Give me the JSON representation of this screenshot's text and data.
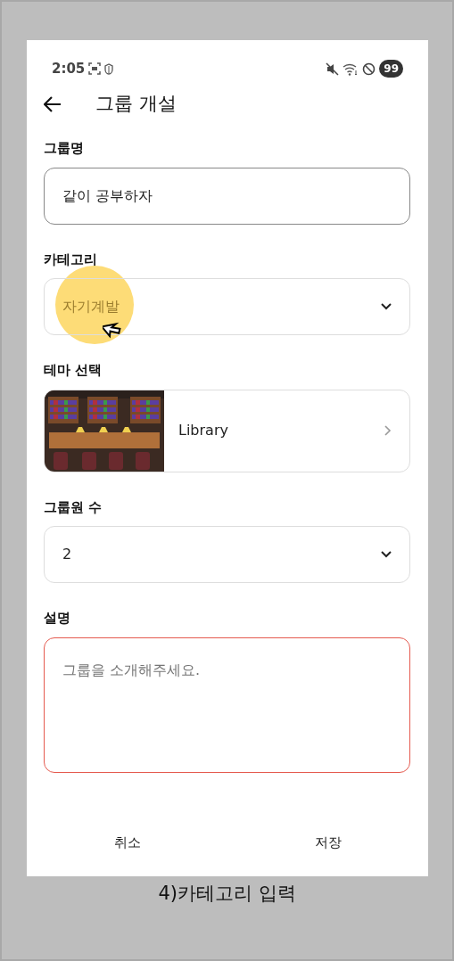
{
  "status_bar": {
    "time": "2:05",
    "battery": "99"
  },
  "header": {
    "title": "그룹 개설"
  },
  "fields": [
    {
      "kind": "text",
      "label": "그룹명",
      "value": "같이 공부하자",
      "highlighted": false,
      "error": false
    },
    {
      "kind": "select",
      "label": "카테고리",
      "value": "자기계발",
      "highlighted": true,
      "error": false
    },
    {
      "kind": "theme",
      "label": "테마 선택",
      "value": "Library",
      "highlighted": false,
      "error": false
    },
    {
      "kind": "select",
      "label": "그룹원 수",
      "value": "2",
      "highlighted": false,
      "error": false
    },
    {
      "kind": "textarea",
      "label": "설명",
      "placeholder": "그룹을 소개해주세요.",
      "highlighted": false,
      "error": true
    }
  ],
  "buttons": [
    "취소",
    "저장"
  ],
  "caption": "4)카테고리 입력"
}
